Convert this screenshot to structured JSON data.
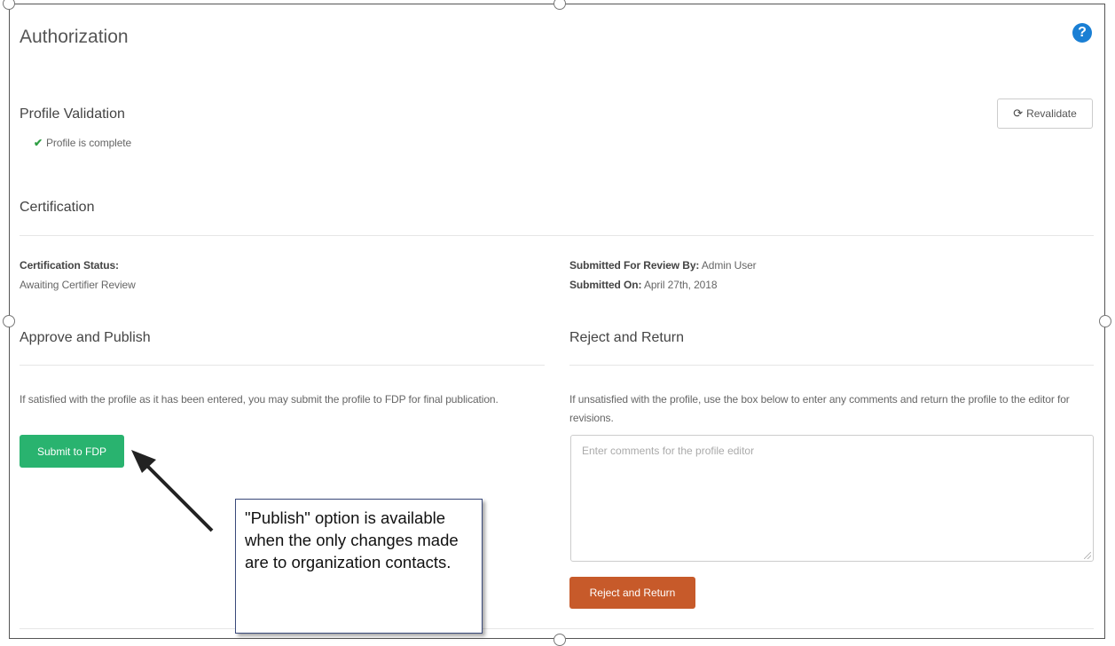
{
  "page": {
    "title": "Authorization",
    "help_icon": "?"
  },
  "profile_validation": {
    "heading": "Profile Validation",
    "status_icon": "check-icon",
    "status_text": "Profile is complete",
    "revalidate_label": "Revalidate"
  },
  "certification": {
    "heading": "Certification",
    "status_label": "Certification Status:",
    "status_value": "Awaiting Certifier Review",
    "submitted_by_label": "Submitted For Review By:",
    "submitted_by_value": "Admin User",
    "submitted_on_label": "Submitted On:",
    "submitted_on_value": "April 27th, 2018"
  },
  "approve": {
    "heading": "Approve and Publish",
    "description": "If satisfied with the profile as it has been entered, you may submit the profile to FDP for final publication.",
    "button_label": "Submit to FDP",
    "button_color": "#29b36f"
  },
  "reject": {
    "heading": "Reject and Return",
    "description": "If unsatisfied with the profile, use the box below to enter any comments and return the profile to the editor for revisions.",
    "comments_placeholder": "Enter comments for the profile editor",
    "button_label": "Reject and Return",
    "button_color": "#c75a2a"
  },
  "callout": {
    "text": "\"Publish\" option is available when the only changes made are to organization contacts."
  }
}
